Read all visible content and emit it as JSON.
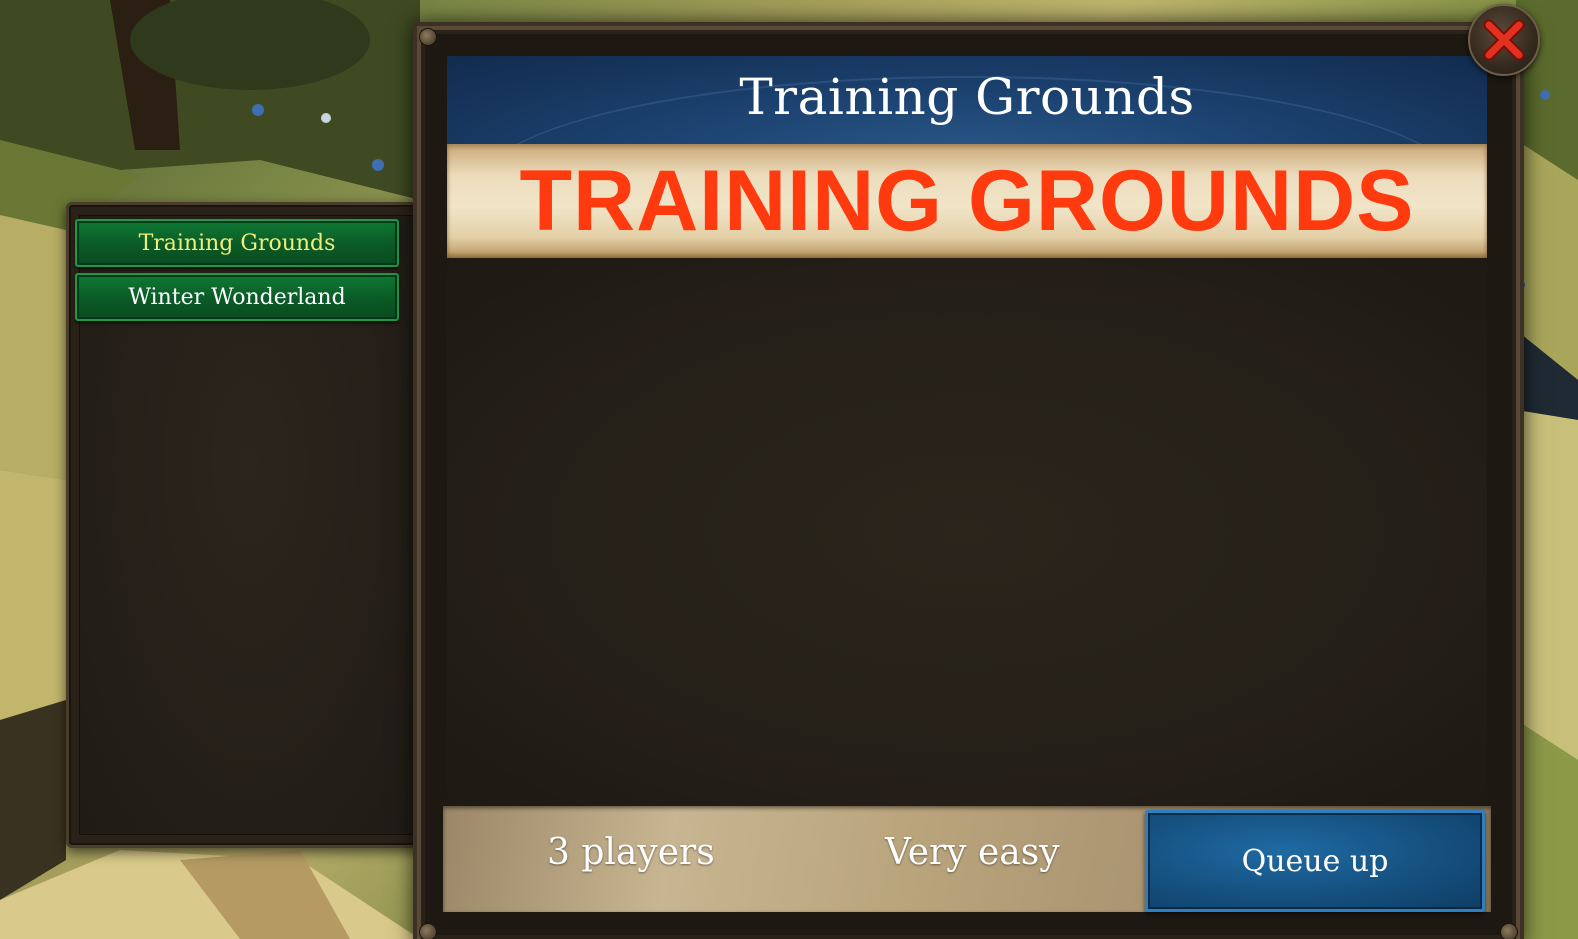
{
  "map_list": {
    "items": [
      {
        "label": "Training Grounds",
        "selected": true
      },
      {
        "label": "Winter Wonderland",
        "selected": false
      }
    ]
  },
  "dialog": {
    "title": "Training Grounds",
    "banner_text": "TRAINING GROUNDS",
    "players": "3 players",
    "difficulty": "Very easy",
    "queue_label": "Queue up"
  },
  "icons": {
    "close": "close-x-icon"
  },
  "colors": {
    "selected_item_text": "#f2ee7a",
    "banner_text": "#ff3a0e",
    "list_item_green": "#0b5a26",
    "title_blue": "#1c4270",
    "queue_blue": "#15507f",
    "close_red": "#d6281c"
  }
}
